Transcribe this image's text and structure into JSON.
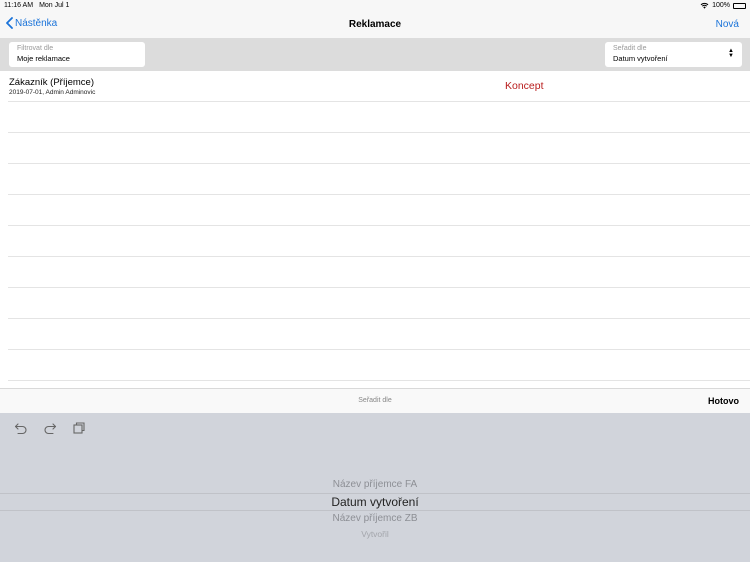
{
  "status": {
    "time": "11:16 AM",
    "date": "Mon Jul 1",
    "battery": "100%"
  },
  "nav": {
    "back_label": "Nástěnka",
    "title": "Reklamace",
    "new_label": "Nová"
  },
  "filter": {
    "label": "Filtrovat dle",
    "value": "Moje reklamace"
  },
  "sort": {
    "label": "Seřadit dle",
    "value": "Datum vytvoření"
  },
  "rows": [
    {
      "title": "Zákazník (Příjemce)",
      "subtitle": "2019-07-01, Admin Adminovic",
      "status": "Koncept"
    }
  ],
  "picker": {
    "title": "Seřadit dle",
    "done_label": "Hotovo",
    "options": [
      "Název příjemce FA",
      "Datum vytvoření",
      "Název příjemce ZB",
      "Vytvořil"
    ],
    "selected": "Datum vytvoření"
  },
  "colors": {
    "accent": "#1a73d9",
    "status_red": "#b81c1c"
  }
}
